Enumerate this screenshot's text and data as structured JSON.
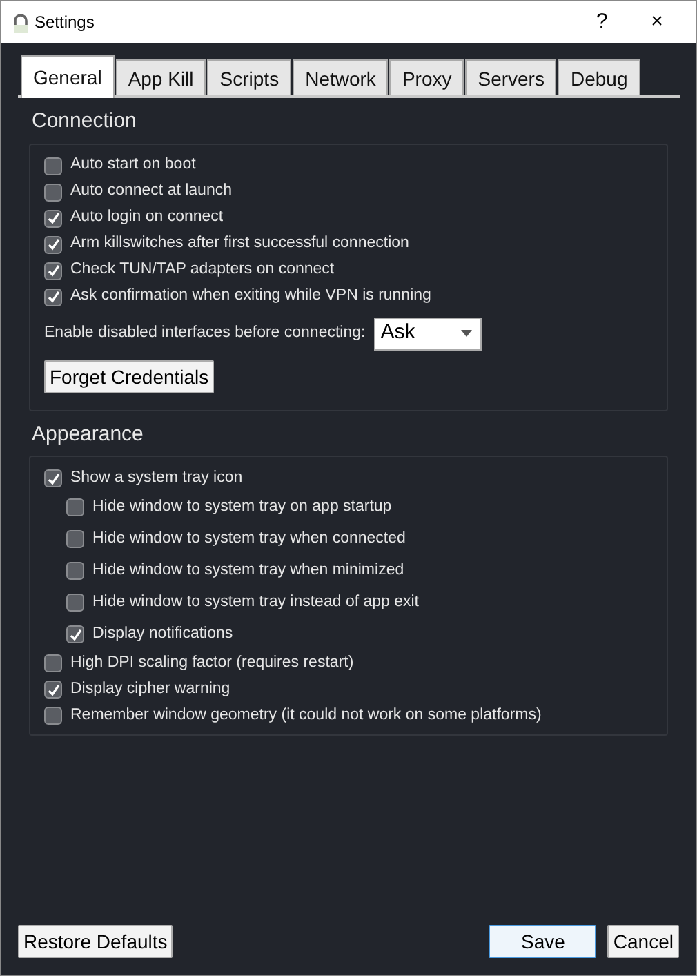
{
  "window": {
    "title": "Settings",
    "help": "?",
    "close": "×"
  },
  "tabs": [
    {
      "label": "General",
      "selected": true
    },
    {
      "label": "App Kill",
      "selected": false
    },
    {
      "label": "Scripts",
      "selected": false
    },
    {
      "label": "Network",
      "selected": false
    },
    {
      "label": "Proxy",
      "selected": false
    },
    {
      "label": "Servers",
      "selected": false
    },
    {
      "label": "Debug",
      "selected": false
    }
  ],
  "sections": [
    {
      "title": "Connection",
      "items": [
        {
          "kind": "checkbox",
          "label": "Auto start on boot",
          "checked": false
        },
        {
          "kind": "checkbox",
          "label": "Auto connect at launch",
          "checked": false
        },
        {
          "kind": "checkbox",
          "label": "Auto login on connect",
          "checked": true
        },
        {
          "kind": "checkbox",
          "label": "Arm killswitches after first successful connection",
          "checked": true
        },
        {
          "kind": "checkbox",
          "label": "Check TUN/TAP adapters on connect",
          "checked": true
        },
        {
          "kind": "checkbox",
          "label": "Ask confirmation when exiting while VPN is running",
          "checked": true
        },
        {
          "kind": "select",
          "label": "Enable disabled interfaces before connecting:",
          "value": "Ask"
        },
        {
          "kind": "button",
          "label": "Forget Credentials"
        }
      ]
    },
    {
      "title": "Appearance",
      "items": [
        {
          "kind": "checkbox",
          "label": "Show a system tray icon",
          "checked": true,
          "children": [
            {
              "kind": "checkbox",
              "label": "Hide window to system tray on app startup",
              "checked": false
            },
            {
              "kind": "checkbox",
              "label": "Hide window to system tray when connected",
              "checked": false
            },
            {
              "kind": "checkbox",
              "label": "Hide window to system tray when minimized",
              "checked": false
            },
            {
              "kind": "checkbox",
              "label": "Hide window to system tray instead of app exit",
              "checked": false
            },
            {
              "kind": "checkbox",
              "label": "Display notifications",
              "checked": true
            }
          ]
        },
        {
          "kind": "checkbox",
          "label": "High DPI scaling factor (requires restart)",
          "checked": false
        },
        {
          "kind": "checkbox",
          "label": "Display cipher warning",
          "checked": true
        },
        {
          "kind": "checkbox",
          "label": "Remember window geometry (it could not work on some platforms)",
          "checked": false
        }
      ]
    }
  ],
  "footer": {
    "left": [
      {
        "label": "Restore Defaults",
        "default": false
      }
    ],
    "right": [
      {
        "label": "Save",
        "default": true
      },
      {
        "label": "Cancel",
        "default": false
      }
    ]
  }
}
